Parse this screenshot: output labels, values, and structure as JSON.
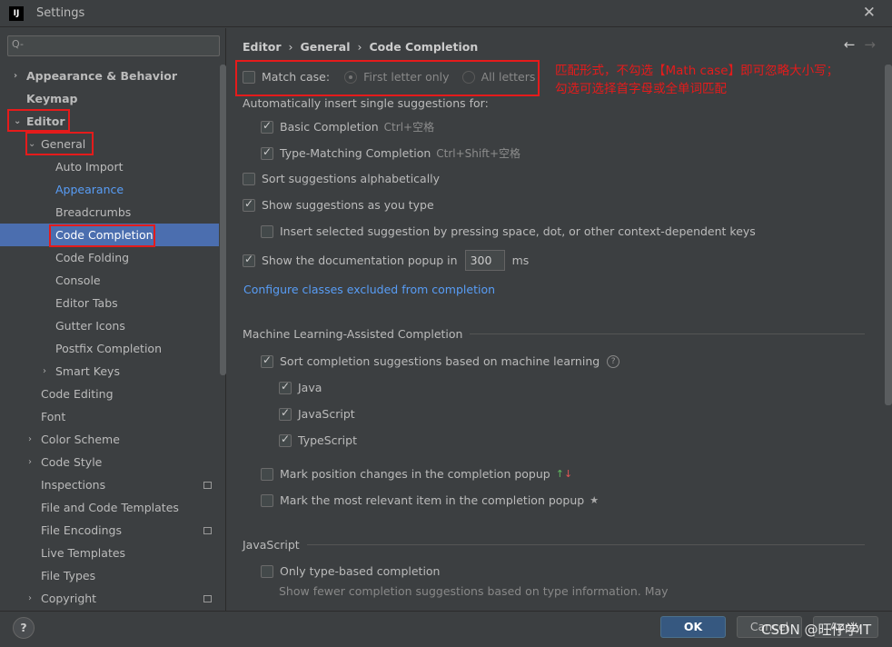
{
  "window": {
    "title": "Settings",
    "logo": "IJ"
  },
  "search": {
    "placeholder": "Q-"
  },
  "tree": [
    {
      "label": "Appearance & Behavior",
      "indent": 0,
      "arrow": "›",
      "bold": true
    },
    {
      "label": "Keymap",
      "indent": 0,
      "bold": true
    },
    {
      "label": "Editor",
      "indent": 0,
      "arrow": "⌄",
      "bold": true
    },
    {
      "label": "General",
      "indent": 1,
      "arrow": "⌄"
    },
    {
      "label": "Auto Import",
      "indent": 2
    },
    {
      "label": "Appearance",
      "indent": 2,
      "link": true
    },
    {
      "label": "Breadcrumbs",
      "indent": 2
    },
    {
      "label": "Code Completion",
      "indent": 2,
      "selected": true
    },
    {
      "label": "Code Folding",
      "indent": 2
    },
    {
      "label": "Console",
      "indent": 2
    },
    {
      "label": "Editor Tabs",
      "indent": 2
    },
    {
      "label": "Gutter Icons",
      "indent": 2
    },
    {
      "label": "Postfix Completion",
      "indent": 2
    },
    {
      "label": "Smart Keys",
      "indent": 2,
      "arrow": "›",
      "arrowIndent": true
    },
    {
      "label": "Code Editing",
      "indent": 1
    },
    {
      "label": "Font",
      "indent": 1
    },
    {
      "label": "Color Scheme",
      "indent": 1,
      "arrow": "›"
    },
    {
      "label": "Code Style",
      "indent": 1,
      "arrow": "›"
    },
    {
      "label": "Inspections",
      "indent": 1,
      "badge": true
    },
    {
      "label": "File and Code Templates",
      "indent": 1
    },
    {
      "label": "File Encodings",
      "indent": 1,
      "badge": true
    },
    {
      "label": "Live Templates",
      "indent": 1
    },
    {
      "label": "File Types",
      "indent": 1
    },
    {
      "label": "Copyright",
      "indent": 1,
      "arrow": "›",
      "badge": true
    }
  ],
  "breadcrumb": [
    "Editor",
    "General",
    "Code Completion"
  ],
  "nav": {
    "back": "←",
    "forward": "→"
  },
  "match_case": {
    "label": "Match case:",
    "checked": false,
    "options": [
      "First letter only",
      "All letters"
    ],
    "selected": "First letter only"
  },
  "annotation": [
    "匹配形式，不勾选【Math case】即可忽略大小写；",
    "勾选可选择首字母或全单词匹配"
  ],
  "auto_insert": {
    "label": "Automatically insert single suggestions for:",
    "basic": {
      "label": "Basic Completion",
      "shortcut": "Ctrl+空格",
      "checked": true
    },
    "type": {
      "label": "Type-Matching Completion",
      "shortcut": "Ctrl+Shift+空格",
      "checked": true
    }
  },
  "sort_alpha": {
    "label": "Sort suggestions alphabetically",
    "checked": false
  },
  "show_as_type": {
    "label": "Show suggestions as you type",
    "checked": true
  },
  "insert_space": {
    "label": "Insert selected suggestion by pressing space, dot, or other context-dependent keys",
    "checked": false
  },
  "doc_popup": {
    "label": "Show the documentation popup in",
    "value": "300",
    "unit": "ms",
    "checked": true
  },
  "configure_link": "Configure classes excluded from completion",
  "ml": {
    "title": "Machine Learning-Assisted Completion",
    "sort": {
      "label": "Sort completion suggestions based on machine learning",
      "checked": true
    },
    "langs": [
      {
        "label": "Java",
        "checked": true
      },
      {
        "label": "JavaScript",
        "checked": true
      },
      {
        "label": "TypeScript",
        "checked": true
      }
    ],
    "mark_pos": {
      "label": "Mark position changes in the completion popup",
      "checked": false
    },
    "mark_rel": {
      "label": "Mark the most relevant item in the completion popup",
      "checked": false
    }
  },
  "js": {
    "title": "JavaScript",
    "only_type": {
      "label": "Only type-based completion",
      "checked": false
    },
    "desc": "Show fewer completion suggestions based on type information. May"
  },
  "buttons": {
    "ok": "OK",
    "cancel": "Cancel",
    "apply": "Apply",
    "help": "?"
  },
  "watermark": "CSDN @旺仔学IT",
  "colors": {
    "selection": "#4b6eaf",
    "link": "#589df6",
    "annotation": "#e51b1b",
    "ok": "#365880"
  }
}
